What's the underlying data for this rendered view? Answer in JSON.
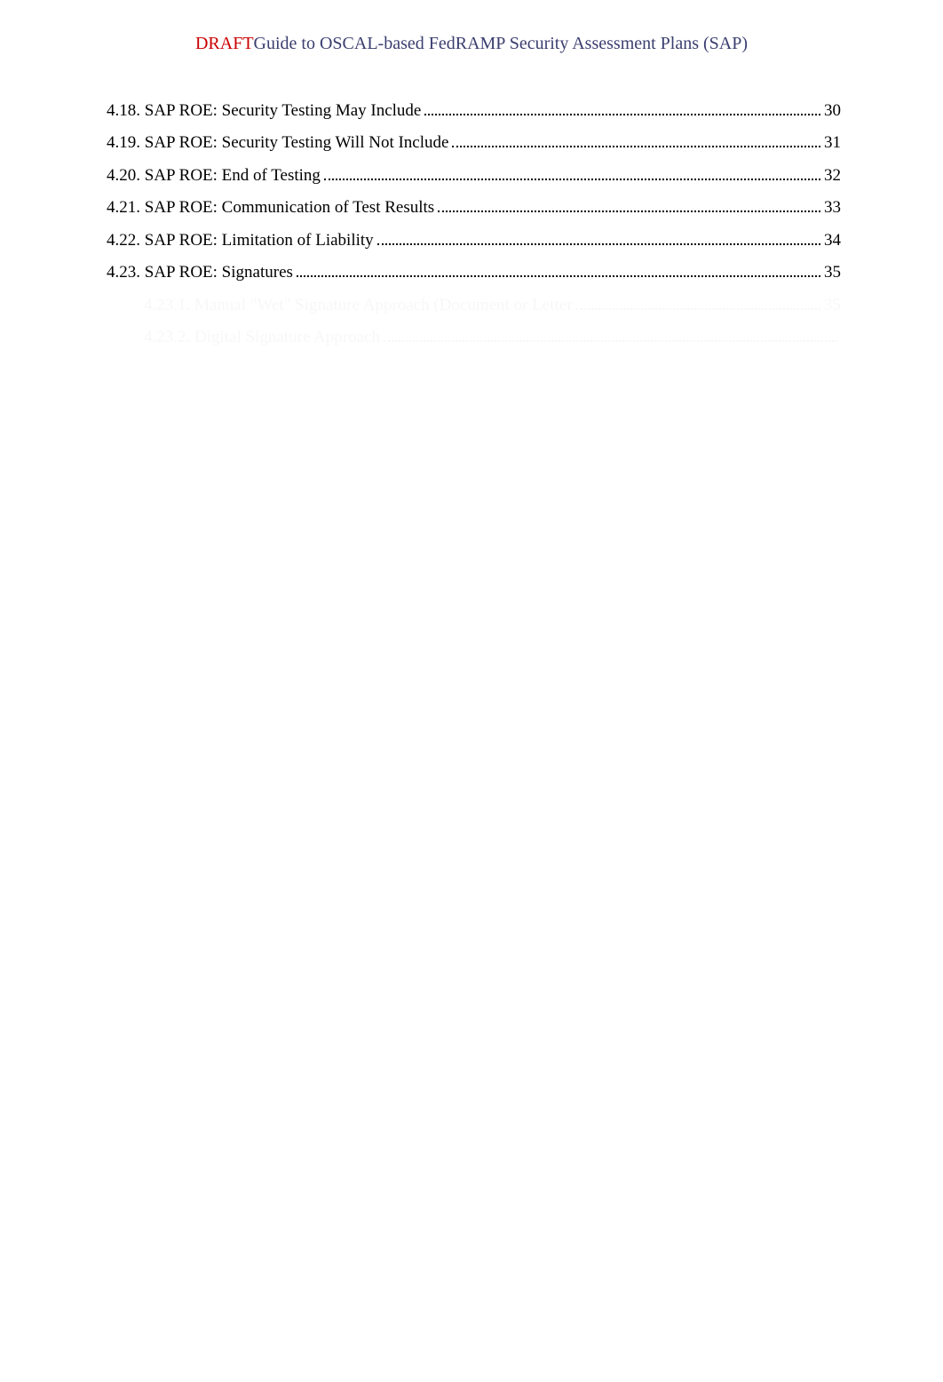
{
  "header": {
    "draft": "DRAFT",
    "title": "Guide to OSCAL-based FedRAMP Security Assessment Plans (SAP)"
  },
  "toc": [
    {
      "indent": 0,
      "title": "4.18. SAP ROE: Security Testing May Include",
      "page": "30"
    },
    {
      "indent": 0,
      "title": "4.19. SAP ROE: Security Testing Will Not Include",
      "page": "31"
    },
    {
      "indent": 0,
      "title": "4.20. SAP ROE: End of Testing",
      "page": "32"
    },
    {
      "indent": 0,
      "title": "4.21. SAP ROE: Communication of Test Results",
      "page": "33"
    },
    {
      "indent": 0,
      "title": "4.22. SAP ROE: Limitation of Liability",
      "page": "34"
    },
    {
      "indent": 0,
      "title": "4.23. SAP ROE: Signatures",
      "page": "35"
    },
    {
      "indent": 1,
      "title": "4.23.1. Manual \"Wet\" Signature Approach (Document or Letter",
      "page": "35"
    },
    {
      "indent": 1,
      "title": "4.23.2. Digital Signature Approach",
      "page": ""
    }
  ]
}
